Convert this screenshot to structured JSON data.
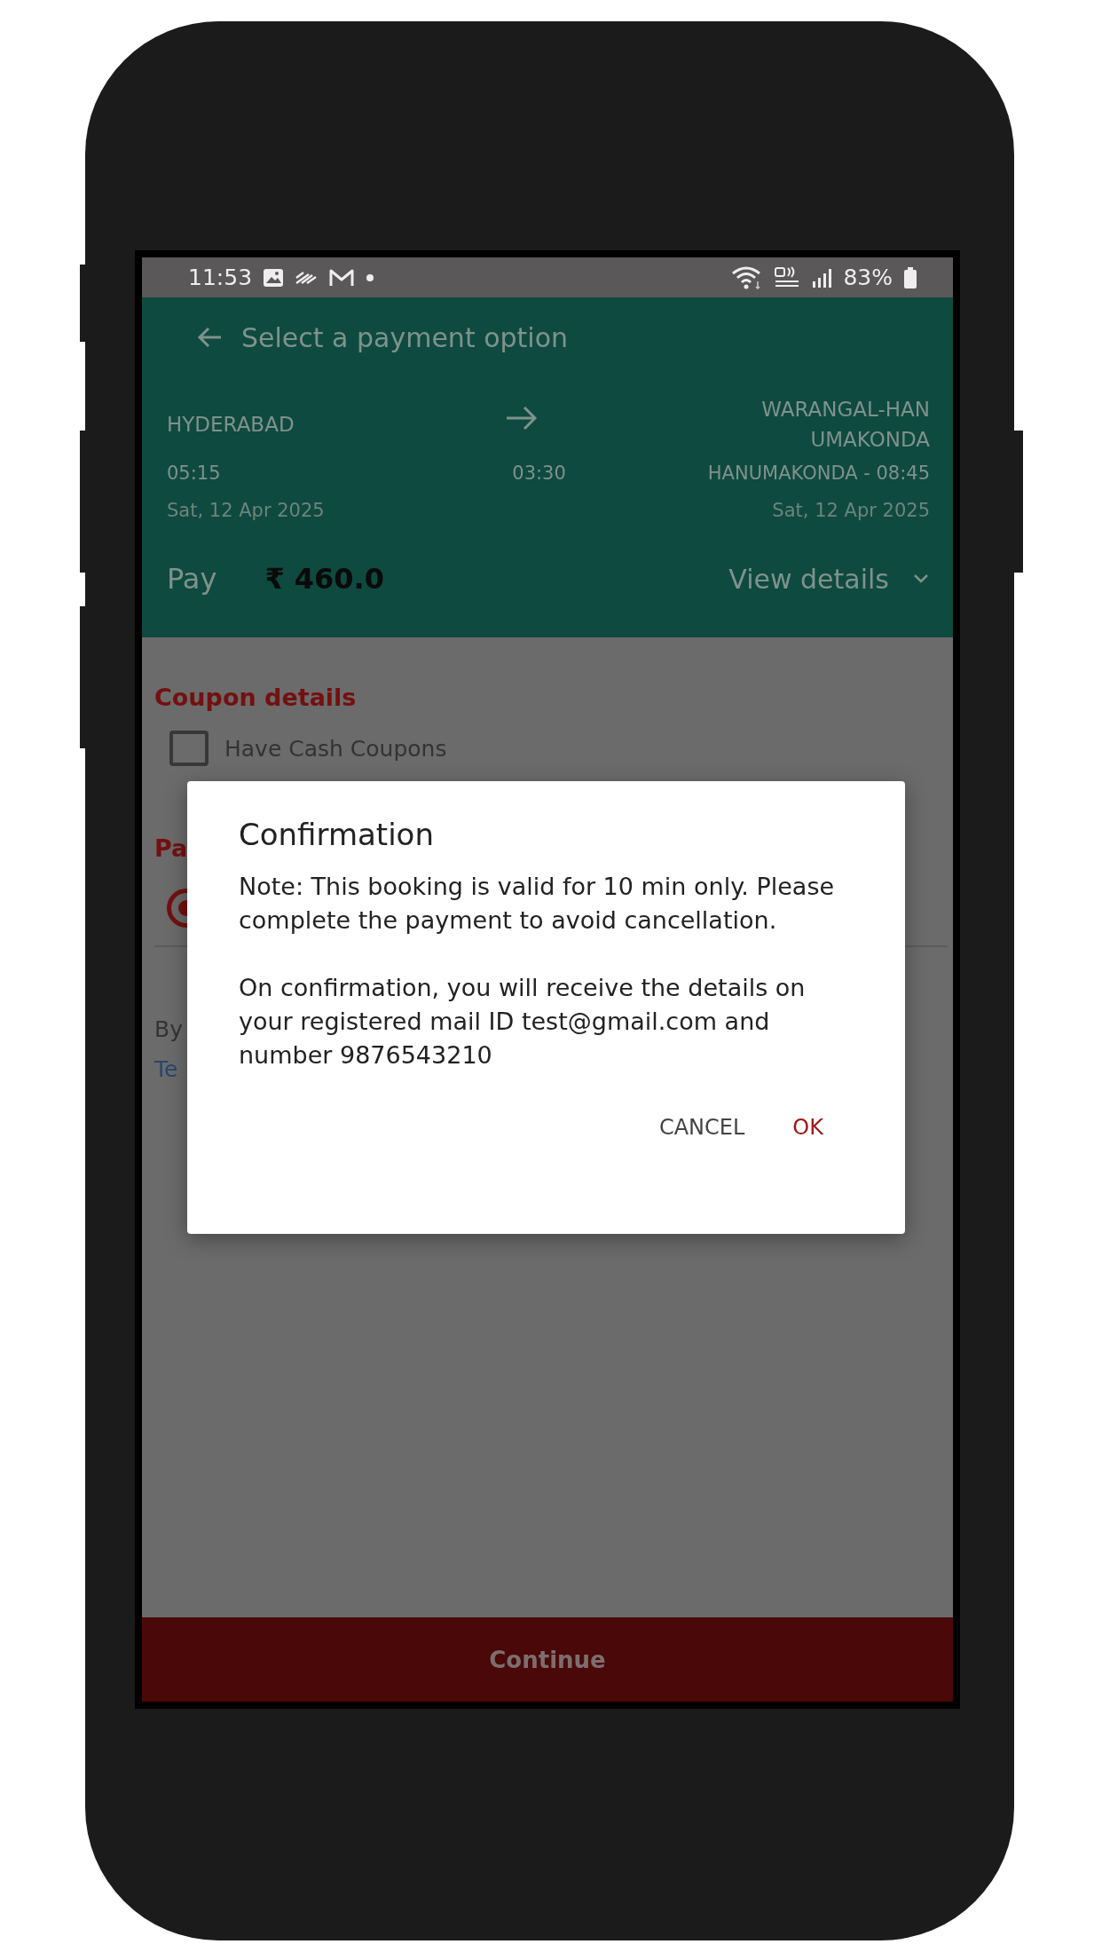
{
  "status_bar": {
    "time": "11:53",
    "battery": "83%"
  },
  "header": {
    "title": "Select a payment option",
    "route": {
      "from": "HYDERABAD",
      "to_lines": [
        "WARANGAL-HAN",
        "UMAKONDA"
      ],
      "departure": "05:15",
      "duration": "03:30",
      "arrival": "HANUMAKONDA - 08:45",
      "departure_date": "Sat, 12 Apr 2025",
      "arrival_date": "Sat, 12 Apr 2025"
    },
    "pay_label": "Pay",
    "amount": "₹ 460.0",
    "view_details": "View details"
  },
  "coupon": {
    "heading": "Coupon details",
    "checkbox": {
      "label": "Have Cash Coupons",
      "checked": false
    }
  },
  "payment": {
    "heading": "Pa",
    "radio": {
      "selected": true
    },
    "terms_text": "By",
    "terms_link": "Te"
  },
  "dialog": {
    "title": "Confirmation",
    "paragraphs": [
      "Note: This booking is valid for 10 min only. Please complete the payment to avoid cancellation.",
      "On confirmation, you will receive the details on your registered mail ID test@gmail.com and number 9876543210"
    ],
    "buttons": [
      {
        "label": "CANCEL",
        "kind": "cancel"
      },
      {
        "label": "OK",
        "kind": "ok"
      }
    ]
  },
  "continue_button": "Continue"
}
